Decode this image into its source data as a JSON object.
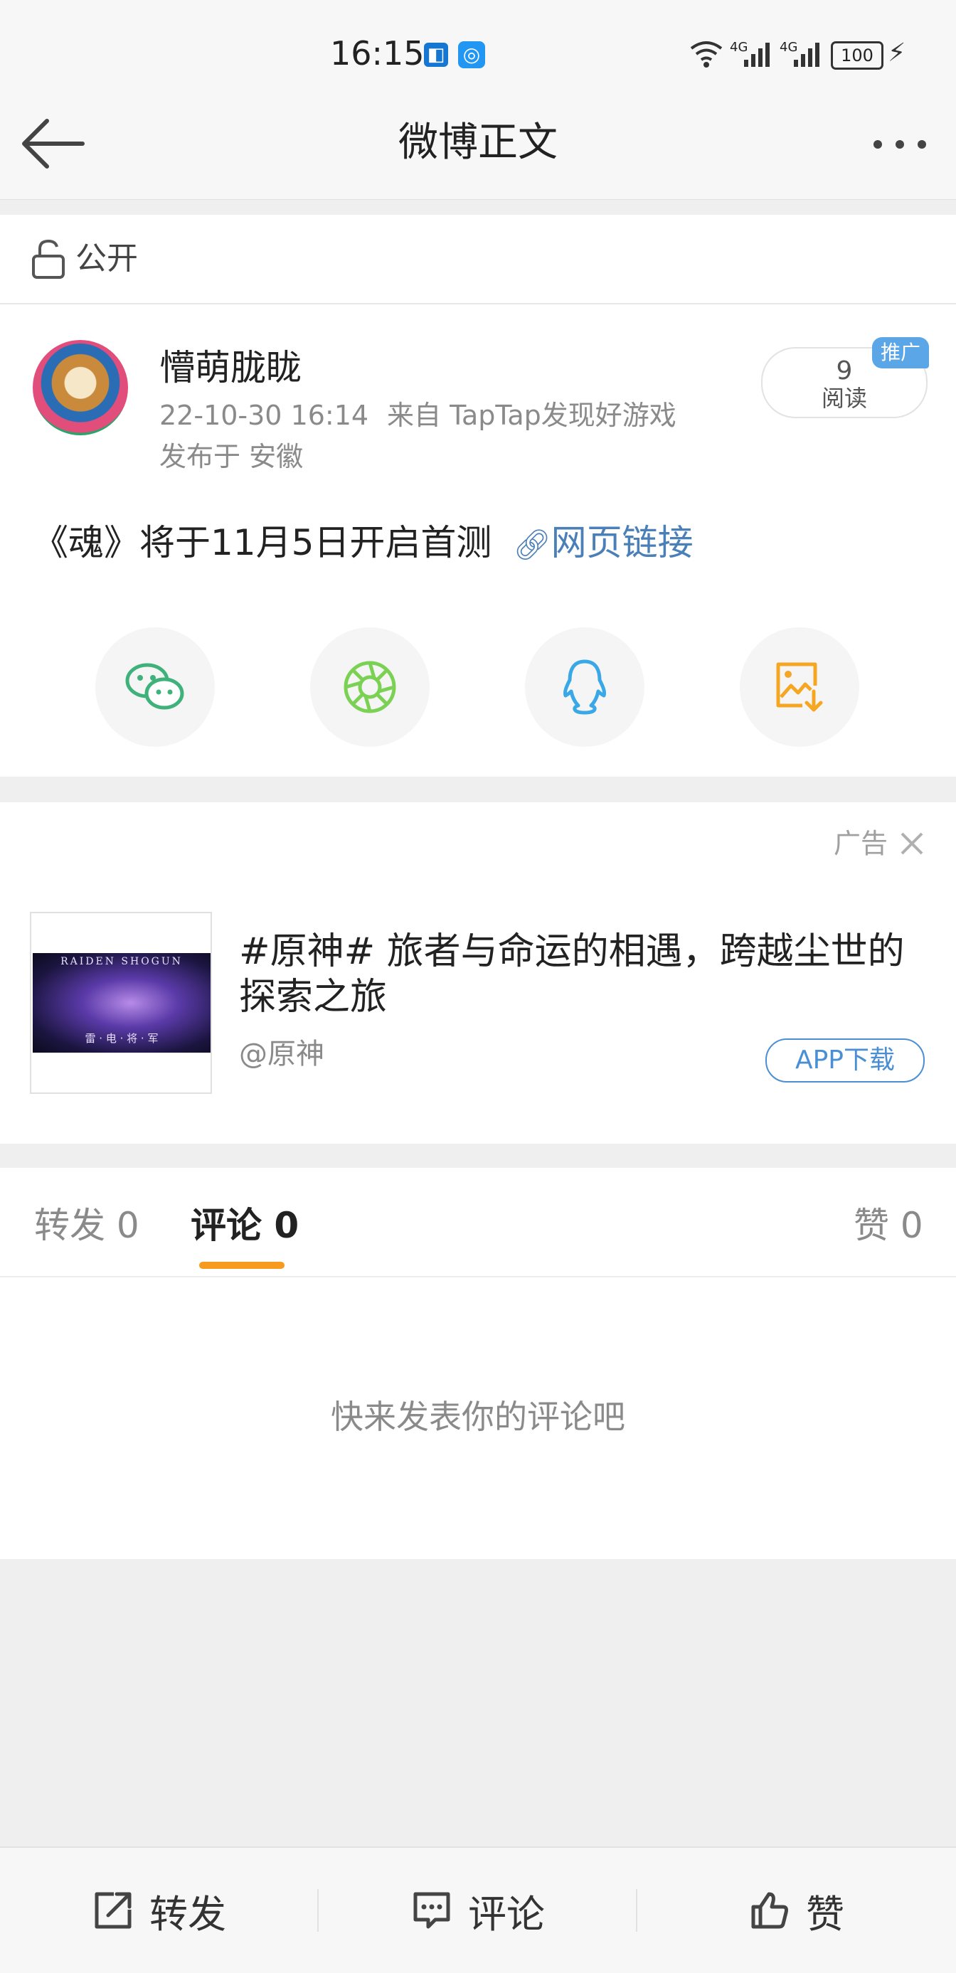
{
  "status_bar": {
    "time": "16:15",
    "network_1": "4G",
    "network_2": "4G",
    "battery": "100"
  },
  "nav": {
    "title": "微博正文"
  },
  "visibility": {
    "label": "公开"
  },
  "post": {
    "username": "懵萌胧眬",
    "time": "22-10-30 16:14",
    "source": "来自 TapTap发现好游戏",
    "location": "发布于 安徽",
    "reads": "9",
    "reads_label": "阅读",
    "promo_badge": "推广",
    "content": "《魂》将于11月5日开启首测",
    "link_text": "网页链接"
  },
  "share_icons": [
    "wechat-icon",
    "moments-icon",
    "qq-icon",
    "save-image-icon"
  ],
  "ad": {
    "label": "广告",
    "title": "#原神# 旅者与命运的相遇，跨越尘世的探索之旅",
    "account": "@原神",
    "button": "APP下载",
    "image_title": "RAIDEN SHOGUN",
    "image_subtitle": "雷 · 电 · 将 · 军"
  },
  "tabs": {
    "repost": "转发 0",
    "comment": "评论 0",
    "like": "赞 0"
  },
  "empty_comment": "快来发表你的评论吧",
  "bottom_bar": {
    "repost": "转发",
    "comment": "评论",
    "like": "赞"
  },
  "colors": {
    "accent_orange": "#f79a1e",
    "link_blue": "#4a7fb8",
    "badge_blue": "#5aa6e6"
  }
}
